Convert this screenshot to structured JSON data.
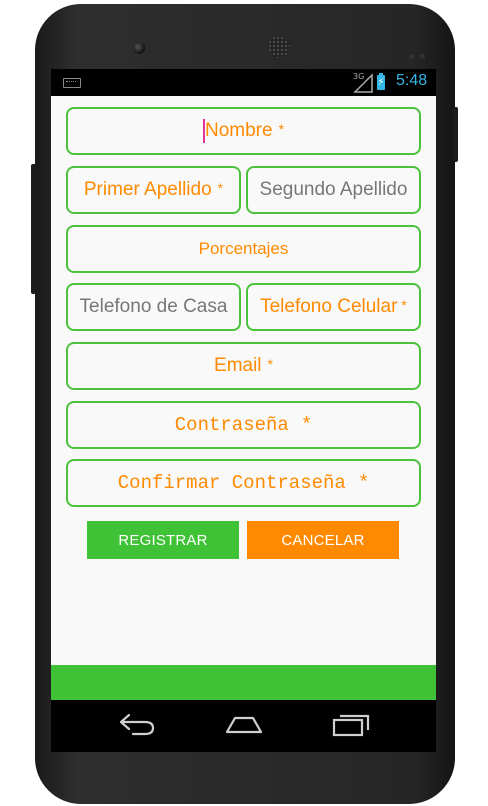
{
  "status_bar": {
    "network_type": "3G",
    "time": "5:48",
    "icons": [
      "keyboard-icon",
      "signal-icon",
      "battery-charging-icon"
    ]
  },
  "form": {
    "nombre": {
      "placeholder": "Nombre",
      "required": "*"
    },
    "primer_apellido": {
      "placeholder": "Primer Apellido",
      "required": "*"
    },
    "segundo_apellido": {
      "placeholder": "Segundo Apellido"
    },
    "porcentajes": {
      "placeholder": "Porcentajes"
    },
    "telefono_casa": {
      "placeholder": "Telefono de Casa"
    },
    "telefono_celular": {
      "placeholder": "Telefono Celular",
      "required": "*"
    },
    "email": {
      "placeholder": "Email",
      "required": "*"
    },
    "contrasena": {
      "placeholder": "Contraseña",
      "required": "*"
    },
    "confirmar_contrasena": {
      "placeholder": "Confirmar Contraseña",
      "required": "*"
    }
  },
  "buttons": {
    "registrar": "REGISTRAR",
    "cancelar": "CANCELAR"
  },
  "nav_bar": {
    "icons": [
      "back-icon",
      "home-icon",
      "recent-apps-icon"
    ]
  },
  "colors": {
    "accent_green": "#3fc235",
    "accent_orange": "#ff8a00",
    "field_border": "#4cc23c",
    "status_blue": "#33b5e5"
  }
}
